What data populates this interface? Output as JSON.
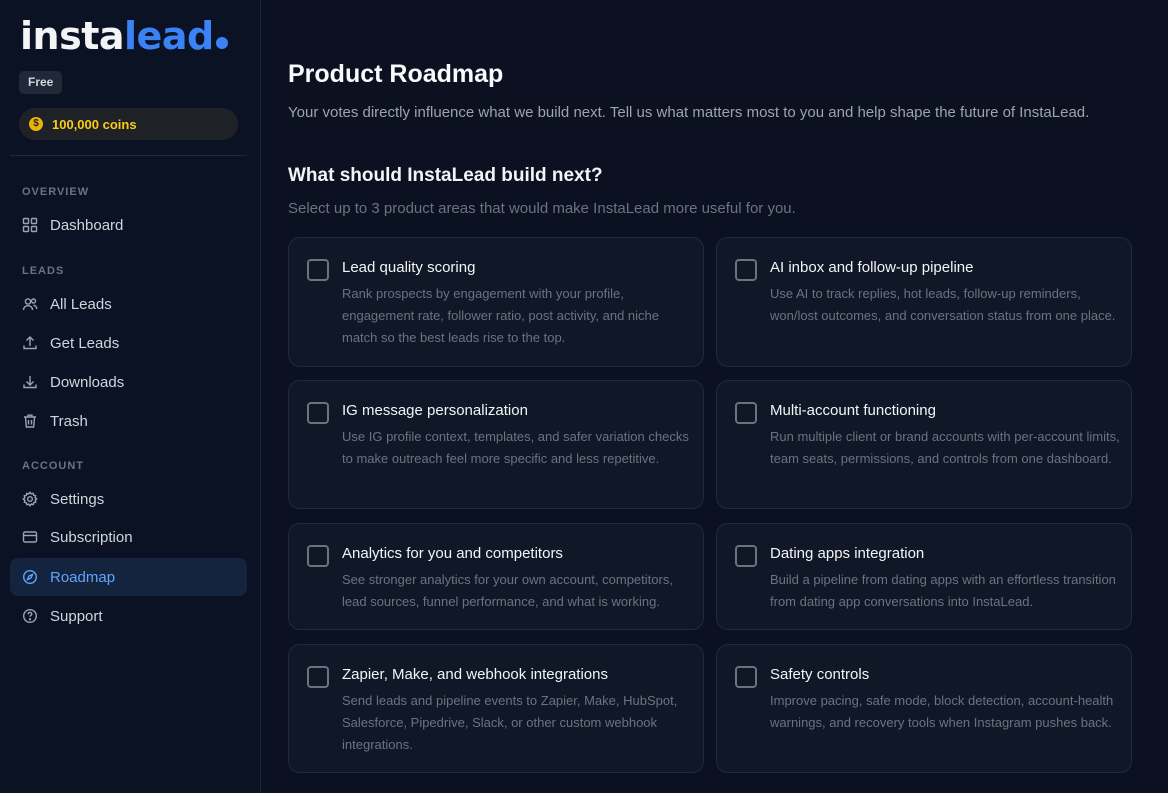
{
  "brand": {
    "name_part1": "insta",
    "name_part2": "lead"
  },
  "plan": "Free",
  "coins": "100,000 coins",
  "coin_symbol": "$",
  "nav": {
    "overview_label": "OVERVIEW",
    "leads_label": "LEADS",
    "account_label": "ACCOUNT",
    "dashboard": "Dashboard",
    "all_leads": "All Leads",
    "get_leads": "Get Leads",
    "downloads": "Downloads",
    "trash": "Trash",
    "settings": "Settings",
    "subscription": "Subscription",
    "roadmap": "Roadmap",
    "support": "Support",
    "active_item": "Roadmap"
  },
  "page": {
    "title": "Product Roadmap",
    "subtitle": "Your votes directly influence what we build next. Tell us what matters most to you and help shape the future of InstaLead."
  },
  "vote": {
    "title": "What should InstaLead build next?",
    "subtitle": "Select up to 3 product areas that would make InstaLead more useful for you."
  },
  "cards": [
    {
      "title": "Lead quality scoring",
      "desc": "Rank prospects by engagement with your profile, engagement rate, follower ratio, post activity, and niche match so the best leads rise to the top.",
      "checked": false
    },
    {
      "title": "AI inbox and follow-up pipeline",
      "desc": "Use AI to track replies, hot leads, follow-up reminders, won/lost outcomes, and conversation status from one place.",
      "checked": false
    },
    {
      "title": "IG message personalization",
      "desc": "Use IG profile context, templates, and safer variation checks to make outreach feel more specific and less repetitive.",
      "checked": false
    },
    {
      "title": "Multi-account functioning",
      "desc": "Run multiple client or brand accounts with per-account limits, team seats, permissions, and controls from one dashboard.",
      "checked": false
    },
    {
      "title": "Analytics for you and competitors",
      "desc": "See stronger analytics for your own account, competitors, lead sources, funnel performance, and what is working.",
      "checked": false
    },
    {
      "title": "Dating apps integration",
      "desc": "Build a pipeline from dating apps with an effortless transition from dating app conversations into InstaLead.",
      "checked": false
    },
    {
      "title": "Zapier, Make, and webhook integrations",
      "desc": "Send leads and pipeline events to Zapier, Make, HubSpot, Salesforce, Pipedrive, Slack, or other custom webhook integrations.",
      "checked": false
    },
    {
      "title": "Safety controls",
      "desc": "Improve pacing, safe mode, block detection, account-health warnings, and recovery tools when Instagram pushes back.",
      "checked": false
    }
  ],
  "colors": {
    "background": "#0b1120",
    "accent": "#3b82f6",
    "coin": "#facc15",
    "card_bg": "#101828"
  }
}
